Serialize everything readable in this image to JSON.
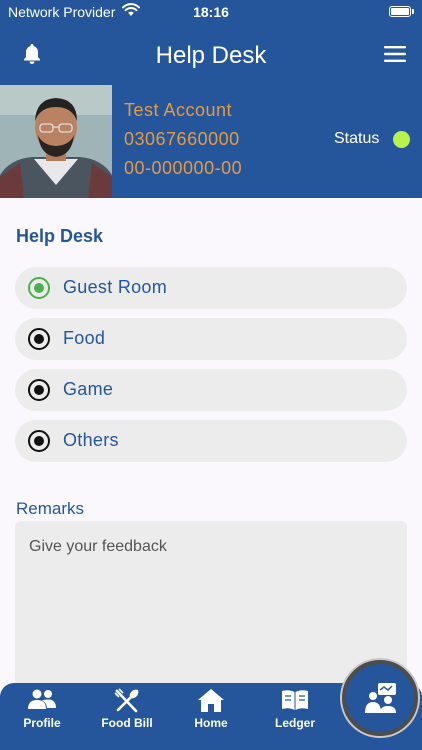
{
  "status_bar": {
    "carrier": "Network Provider",
    "time": "18:16"
  },
  "header": {
    "title": "Help Desk"
  },
  "profile": {
    "name": "Test Account",
    "phone": "03067660000",
    "id_number": "00-000000-00",
    "status_label": "Status",
    "status_color": "#b7f34a"
  },
  "help_desk": {
    "title": "Help Desk",
    "options": [
      {
        "label": "Guest Room",
        "selected": true
      },
      {
        "label": "Food",
        "selected": false
      },
      {
        "label": "Game",
        "selected": false
      },
      {
        "label": "Others",
        "selected": false
      }
    ]
  },
  "remarks": {
    "label": "Remarks",
    "placeholder": "Give your feedback"
  },
  "bottom_nav": {
    "items": [
      {
        "label": "Profile",
        "icon": "users-icon"
      },
      {
        "label": "Food Bill",
        "icon": "fork-spoon-icon"
      },
      {
        "label": "Home",
        "icon": "home-icon"
      },
      {
        "label": "Ledger",
        "icon": "book-icon"
      }
    ],
    "fab_icon": "help-desk-icon"
  },
  "colors": {
    "primary": "#25569b",
    "accent": "#e59b3e",
    "selected_radio": "#4caf50"
  }
}
